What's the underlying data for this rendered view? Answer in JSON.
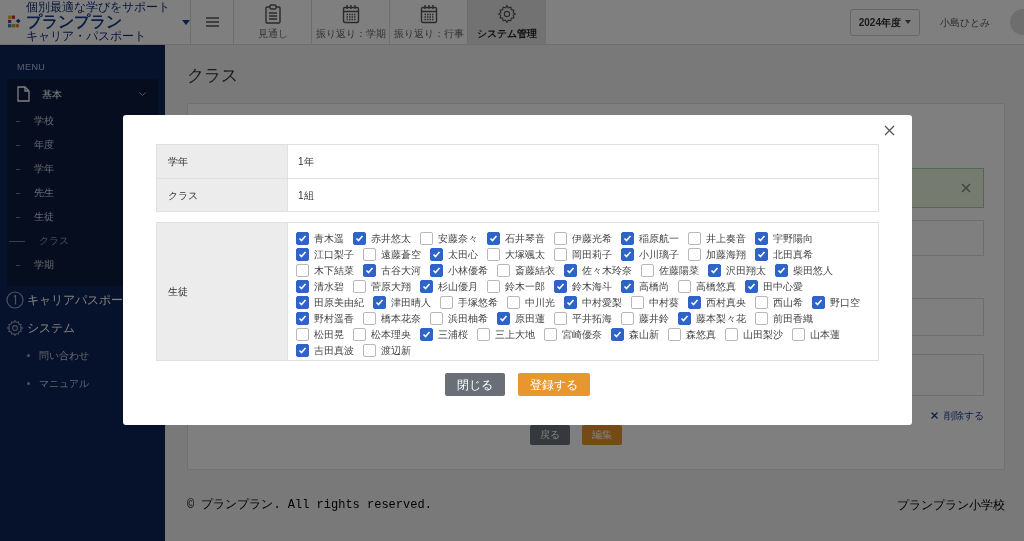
{
  "header": {
    "logo": {
      "tagline": "個別最適な学びをサポート",
      "name": "プランプラン",
      "subtitle": "キャリア・パスポート"
    },
    "nav_tabs": [
      {
        "label": "見通し",
        "selected": false
      },
      {
        "label": "振り返り：学期",
        "selected": false
      },
      {
        "label": "振り返り：行事",
        "selected": false
      },
      {
        "label": "システム管理",
        "selected": true
      }
    ],
    "year_select": "2024年度",
    "user_name": "小島ひとみ"
  },
  "sidebar": {
    "menu_label": "MENU",
    "items": [
      {
        "kind": "group",
        "label": "基本",
        "expanded": true,
        "children": [
          {
            "label": "学校",
            "selected": false
          },
          {
            "label": "年度",
            "selected": false
          },
          {
            "label": "学年",
            "selected": false
          },
          {
            "label": "先生",
            "selected": false
          },
          {
            "label": "生徒",
            "selected": false
          },
          {
            "label": "クラス",
            "selected": true
          },
          {
            "label": "学期",
            "selected": false
          }
        ]
      },
      {
        "kind": "numbered",
        "label": "キャリアパスポー"
      },
      {
        "kind": "settings",
        "label": "システム"
      },
      {
        "kind": "link",
        "label": "問い合わせ"
      },
      {
        "kind": "link",
        "label": "マニュアル"
      }
    ]
  },
  "page": {
    "title": "クラス",
    "delete_link": "削除する",
    "buttons": [
      {
        "label": "戻る",
        "kind": "secondary"
      },
      {
        "label": "編集",
        "kind": "primary"
      }
    ],
    "footer": {
      "copyright": "© プランプラン. All rights reserved.",
      "school": "プランプラン小学校"
    }
  },
  "modal": {
    "rows": [
      {
        "label": "学年",
        "value": "1年"
      },
      {
        "label": "クラス",
        "value": "1組"
      }
    ],
    "students_label": "生徒",
    "student_rows": [
      [
        {
          "name": "青木遥",
          "checked": true
        },
        {
          "name": "赤井悠太",
          "checked": true
        },
        {
          "name": "安藤奈々",
          "checked": false
        },
        {
          "name": "石井琴音",
          "checked": true
        },
        {
          "name": "伊藤光希",
          "checked": false
        },
        {
          "name": "稲原航一",
          "checked": true
        },
        {
          "name": "井上奏音",
          "checked": false
        },
        {
          "name": "宇野陽向",
          "checked": true
        }
      ],
      [
        {
          "name": "江口梨子",
          "checked": true
        },
        {
          "name": "遠藤蒼空",
          "checked": false
        },
        {
          "name": "太田心",
          "checked": true
        },
        {
          "name": "大塚颯太",
          "checked": false
        },
        {
          "name": "岡田莉子",
          "checked": false
        },
        {
          "name": "小川璃子",
          "checked": true
        },
        {
          "name": "加藤海翔",
          "checked": false
        },
        {
          "name": "北田真希",
          "checked": true
        }
      ],
      [
        {
          "name": "木下結菜",
          "checked": false
        },
        {
          "name": "古谷大河",
          "checked": true
        },
        {
          "name": "小林優希",
          "checked": true
        },
        {
          "name": "斎藤結衣",
          "checked": false
        },
        {
          "name": "佐々木玲奈",
          "checked": true
        },
        {
          "name": "佐藤陽菜",
          "checked": false
        },
        {
          "name": "沢田翔太",
          "checked": true
        },
        {
          "name": "柴田悠人",
          "checked": true
        }
      ],
      [
        {
          "name": "清水碧",
          "checked": true
        },
        {
          "name": "菅原大翔",
          "checked": false
        },
        {
          "name": "杉山優月",
          "checked": true
        },
        {
          "name": "鈴木一郎",
          "checked": false
        },
        {
          "name": "鈴木海斗",
          "checked": true
        },
        {
          "name": "高橋尚",
          "checked": true
        },
        {
          "name": "高橋悠真",
          "checked": false
        },
        {
          "name": "田中心愛",
          "checked": true
        }
      ],
      [
        {
          "name": "田原美由紀",
          "checked": true
        },
        {
          "name": "津田晴人",
          "checked": true
        },
        {
          "name": "手塚悠希",
          "checked": false
        },
        {
          "name": "中川光",
          "checked": false
        },
        {
          "name": "中村愛梨",
          "checked": true
        },
        {
          "name": "中村葵",
          "checked": false
        },
        {
          "name": "西村真央",
          "checked": true
        },
        {
          "name": "西山希",
          "checked": false
        },
        {
          "name": "野口空",
          "checked": true
        }
      ],
      [
        {
          "name": "野村遥香",
          "checked": true
        },
        {
          "name": "橋本花奈",
          "checked": false
        },
        {
          "name": "浜田柚希",
          "checked": false
        },
        {
          "name": "原田蓮",
          "checked": true
        },
        {
          "name": "平井拓海",
          "checked": false
        },
        {
          "name": "藤井鈴",
          "checked": false
        },
        {
          "name": "藤本梨々花",
          "checked": true
        },
        {
          "name": "前田香織",
          "checked": false
        }
      ],
      [
        {
          "name": "松田晃",
          "checked": false
        },
        {
          "name": "松本理央",
          "checked": false
        },
        {
          "name": "三浦桜",
          "checked": true
        },
        {
          "name": "三上大地",
          "checked": false
        },
        {
          "name": "宮崎優奈",
          "checked": false
        },
        {
          "name": "森山新",
          "checked": true
        },
        {
          "name": "森悠真",
          "checked": false
        },
        {
          "name": "山田梨沙",
          "checked": false
        },
        {
          "name": "山本蓮",
          "checked": false
        }
      ],
      [
        {
          "name": "吉田真波",
          "checked": true
        },
        {
          "name": "渡辺新",
          "checked": false
        }
      ]
    ],
    "buttons": [
      {
        "label": "閉じる",
        "kind": "secondary"
      },
      {
        "label": "登録する",
        "kind": "primary"
      }
    ]
  }
}
